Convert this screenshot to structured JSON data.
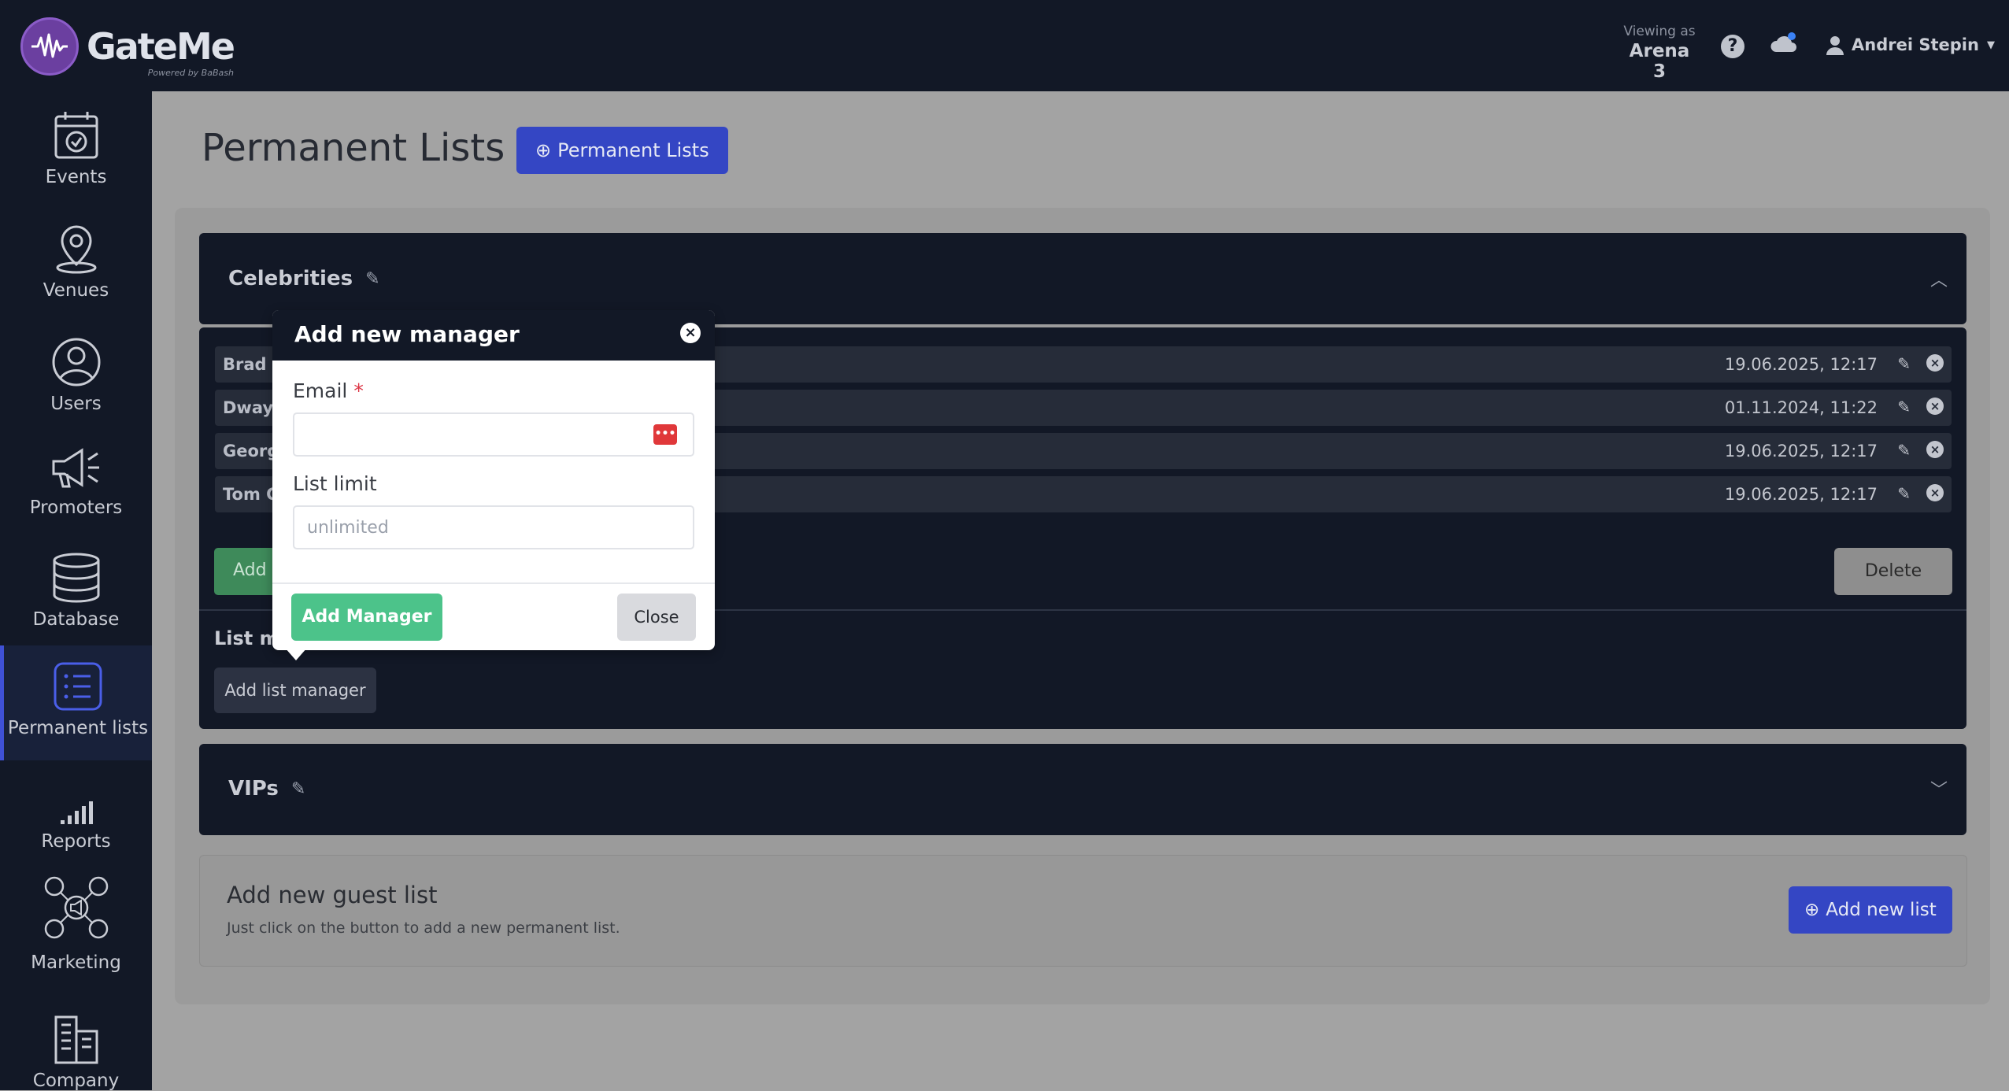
{
  "app": {
    "name": "GateMe",
    "tagline": "Powered by BaBash"
  },
  "topbar": {
    "viewing_label": "Viewing as",
    "viewing_value": "Arena 3",
    "help": "?",
    "user_name": "Andrei Stepin"
  },
  "sidebar": {
    "items": [
      {
        "label": "Events",
        "icon": "calendar-check-icon"
      },
      {
        "label": "Venues",
        "icon": "map-pin-icon"
      },
      {
        "label": "Users",
        "icon": "user-circle-icon"
      },
      {
        "label": "Promoters",
        "icon": "megaphone-icon"
      },
      {
        "label": "Database",
        "icon": "database-icon"
      },
      {
        "label": "Permanent lists",
        "icon": "list-icon",
        "active": true
      },
      {
        "label": "Reports",
        "icon": "signal-bars-icon"
      },
      {
        "label": "Marketing",
        "icon": "social-network-icon"
      },
      {
        "label": "Company",
        "icon": "building-icon"
      }
    ]
  },
  "page": {
    "title": "Permanent Lists",
    "header_button": "Permanent Lists"
  },
  "lists": [
    {
      "title": "Celebrities",
      "expanded": true,
      "rows": [
        {
          "name": "Brad I",
          "date": "19.06.2025, 12:17"
        },
        {
          "name": "Dway",
          "date": "01.11.2024, 11:22"
        },
        {
          "name": "Georg",
          "date": "19.06.2025, 12:17"
        },
        {
          "name": "Tom C",
          "date": "19.06.2025, 12:17"
        }
      ],
      "add_label": "Add",
      "delete_label": "Delete",
      "managers_label": "List m",
      "add_manager_label": "Add list manager"
    },
    {
      "title": "VIPs",
      "expanded": false
    }
  ],
  "guest_list": {
    "title": "Add new guest list",
    "description": "Just click on the button to add a new permanent list.",
    "button": "Add new list"
  },
  "modal": {
    "title": "Add new manager",
    "email_label": "Email",
    "required_mark": "*",
    "email_value": "",
    "list_limit_label": "List limit",
    "list_limit_placeholder": "unlimited",
    "submit_label": "Add Manager",
    "close_label": "Close"
  },
  "colors": {
    "navy": "#121826",
    "accent_blue": "#3446c4",
    "success_green": "#4cc38a",
    "danger_red": "#dc3545"
  }
}
